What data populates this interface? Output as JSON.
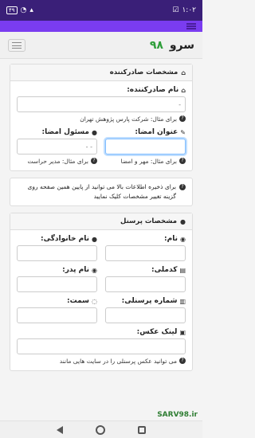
{
  "status": {
    "time": "۱:۰۲",
    "battery": "۴۹"
  },
  "brand": {
    "name": "سرو",
    "number": "۹۸"
  },
  "issuer_card": {
    "title": "مشخصات صادرکننده",
    "issuer_label": "نام صادرکننده:",
    "issuer_value": "-",
    "issuer_help": "برای مثال: شرکت پارس پژوهش تهران",
    "sign_title_label": "عنوان امضا:",
    "sign_title_help": "برای مثال: مهر و امضا",
    "sign_person_label": "مسئول امضا:",
    "sign_person_value": "- -",
    "sign_person_help": "برای مثال: مدیر حراست"
  },
  "info_text": "برای ذخیره اطلاعات بالا می توانید از پایین همین صفحه روی گزینه تغییر مشخصات کلیک نمایید",
  "personnel_card": {
    "title": "مشخصات پرسنل",
    "name_label": "نام:",
    "family_label": "نام خانوادگی:",
    "national_code_label": "کدملی:",
    "father_label": "نام پدر:",
    "personnel_no_label": "شماره پرسنلی:",
    "position_label": "سمت:",
    "photo_label": "لینک عکس:",
    "photo_help": "می توانید عکس پرسنلی را در سایت هایی مانند"
  },
  "watermark": "SARV98.ir"
}
